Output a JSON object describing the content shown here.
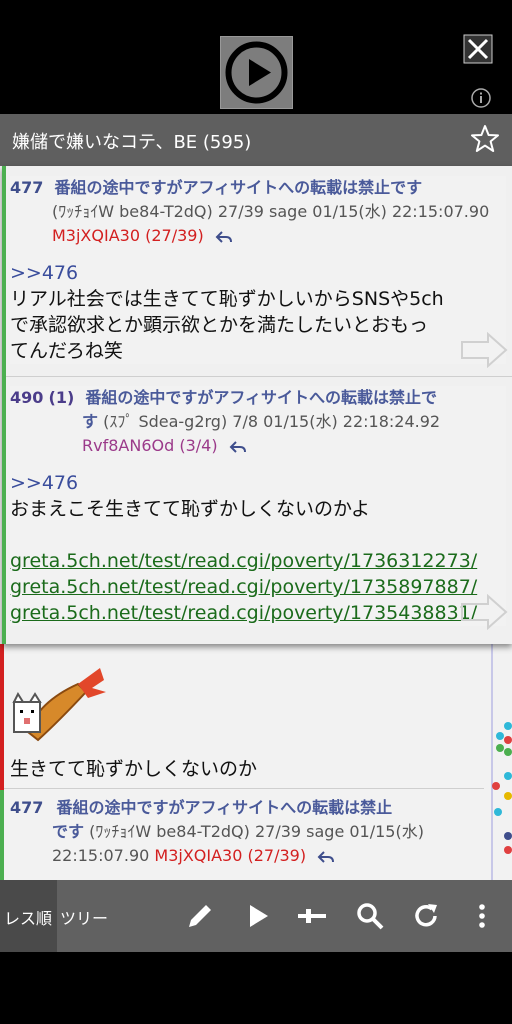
{
  "app": {
    "title": "嫌儲で嫌いなコテ、BE (595)"
  },
  "colors": {
    "accent_green": "#4caf50",
    "id_red": "#d32020",
    "id_purple": "#9b3a8a",
    "link_green": "#1b6b1b"
  },
  "popup": {
    "posts": [
      {
        "number": "477",
        "subject": "番組の途中ですがアフィサイトへの転載は禁止です",
        "meta": "(ﾜｯﾁｮｲW be84-T2dQ) 27/39 sage 01/15(水) 22:15:07.90",
        "meta_l1": "(ﾜｯﾁｮｲW be84-T2dQ) 27/39 sage 01/15(水) 22:15:07.90",
        "id": "M3jXQIA30 (27/39)",
        "anchor": ">>476",
        "body": "リアル社会では生きてて恥ずかしいからSNSや5chで承認欲求とか顕示欲とかを満たしたいとおもってんだろね笑",
        "body_l1": "リアル社会では生きてて恥ずかしいからSNSや5ch",
        "body_l2": "で承認欲求とか顕示欲とかを満たしたいとおもっ",
        "body_l3": "てんだろね笑"
      },
      {
        "number": "490",
        "reply_count": "(1)",
        "subject": "番組の途中ですがアフィサイトへの転載は禁止です",
        "subject_l1": "番組の途中ですがアフィサイトへの転載は禁止で",
        "subject_l2": "す",
        "meta": "(ｽﾌﾟ Sdea-g2rg) 7/8  01/15(水) 22:18:24.92",
        "id": "Rvf8AN6Od (3/4)",
        "anchor": ">>476",
        "body": "おまえこそ生きてて恥ずかしくないのかよ",
        "links": [
          "greta.5ch.net/test/read.cgi/poverty/1736312273/",
          "greta.5ch.net/test/read.cgi/poverty/1735897887/",
          "greta.5ch.net/test/read.cgi/poverty/1735438831/"
        ]
      }
    ]
  },
  "thread": {
    "visible_post_body": "生きてて恥ずかしくないのか",
    "image_icon": "fried-shrimp-cat-icon",
    "bottom_post": {
      "number": "477",
      "subject_l1": "番組の途中ですがアフィサイトへの転載は禁止",
      "subject_l2": "です",
      "meta": "(ﾜｯﾁｮｲW be84-T2dQ) 27/39 sage 01/15(水)",
      "time": "22:15:07.90",
      "id": "M3jXQIA30 (27/39)"
    }
  },
  "toolbar": {
    "tab_order": "レス順",
    "tab_tree": "ツリー",
    "icons": [
      "pencil-icon",
      "play-icon",
      "slider-icon",
      "search-icon",
      "refresh-icon",
      "more-icon"
    ]
  }
}
